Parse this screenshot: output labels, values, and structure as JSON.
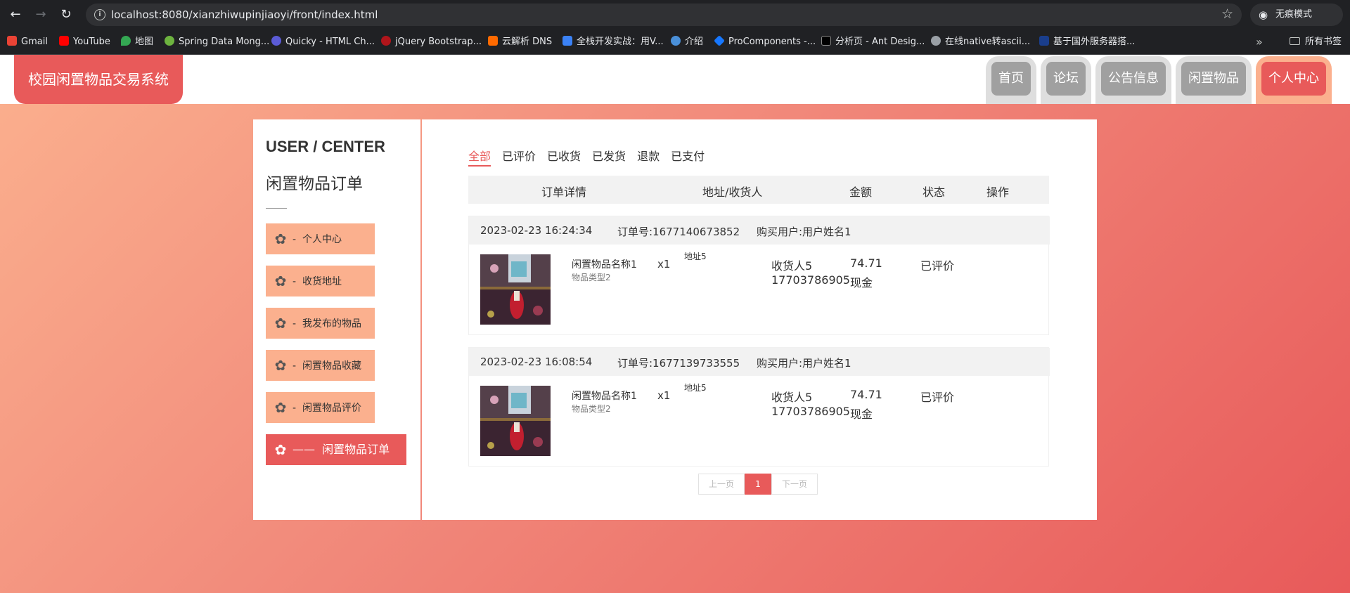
{
  "browser": {
    "url": "localhost:8080/xianzhiwupinjiaoyi/front/index.html",
    "incognito_label": "无痕模式",
    "bookmarks": [
      "Gmail",
      "YouTube",
      "地图",
      "Spring Data Mong...",
      "Quicky - HTML Ch...",
      "jQuery Bootstrap...",
      "云解析 DNS",
      "全栈开发实战：用V...",
      "介绍",
      "ProComponents -...",
      "分析页 - Ant Desig...",
      "在线native转ascii...",
      "基于国外服务器搭..."
    ],
    "all_bookmarks": "所有书签"
  },
  "site": {
    "title": "校园闲置物品交易系统",
    "nav": [
      "首页",
      "论坛",
      "公告信息",
      "闲置物品",
      "个人中心"
    ]
  },
  "sidebar": {
    "heading_en": "USER / CENTER",
    "heading_cn": "闲置物品订单",
    "items": [
      {
        "label": "个人中心",
        "prefix": "-"
      },
      {
        "label": "收货地址",
        "prefix": "-"
      },
      {
        "label": "我发布的物品",
        "prefix": "-"
      },
      {
        "label": "闲置物品收藏",
        "prefix": "-"
      },
      {
        "label": "闲置物品评价",
        "prefix": "-"
      },
      {
        "label": "闲置物品订单",
        "prefix": "——"
      }
    ]
  },
  "tabs": [
    "全部",
    "已评价",
    "已收货",
    "已发货",
    "退款",
    "已支付"
  ],
  "table_header": [
    "订单详情",
    "地址/收货人",
    "金额",
    "状态",
    "操作"
  ],
  "orders": [
    {
      "time": "2023-02-23 16:24:34",
      "order_no": "订单号:1677140673852",
      "buyer": "购买用户:用户姓名1",
      "item_name": "闲置物品名称1",
      "item_type": "物品类型2",
      "qty": "x1",
      "address": "地址5",
      "receiver": "收货人5",
      "phone": "17703786905",
      "amount": "74.71",
      "pay": "现金",
      "status": "已评价"
    },
    {
      "time": "2023-02-23 16:08:54",
      "order_no": "订单号:1677139733555",
      "buyer": "购买用户:用户姓名1",
      "item_name": "闲置物品名称1",
      "item_type": "物品类型2",
      "qty": "x1",
      "address": "地址5",
      "receiver": "收货人5",
      "phone": "17703786905",
      "amount": "74.71",
      "pay": "现金",
      "status": "已评价"
    }
  ],
  "pager": {
    "prev": "上一页",
    "current": "1",
    "next": "下一页"
  },
  "colors": {
    "accent": "#e85a5a",
    "peach": "#fbb08e",
    "inactive_nav": "#a0a0a0"
  }
}
